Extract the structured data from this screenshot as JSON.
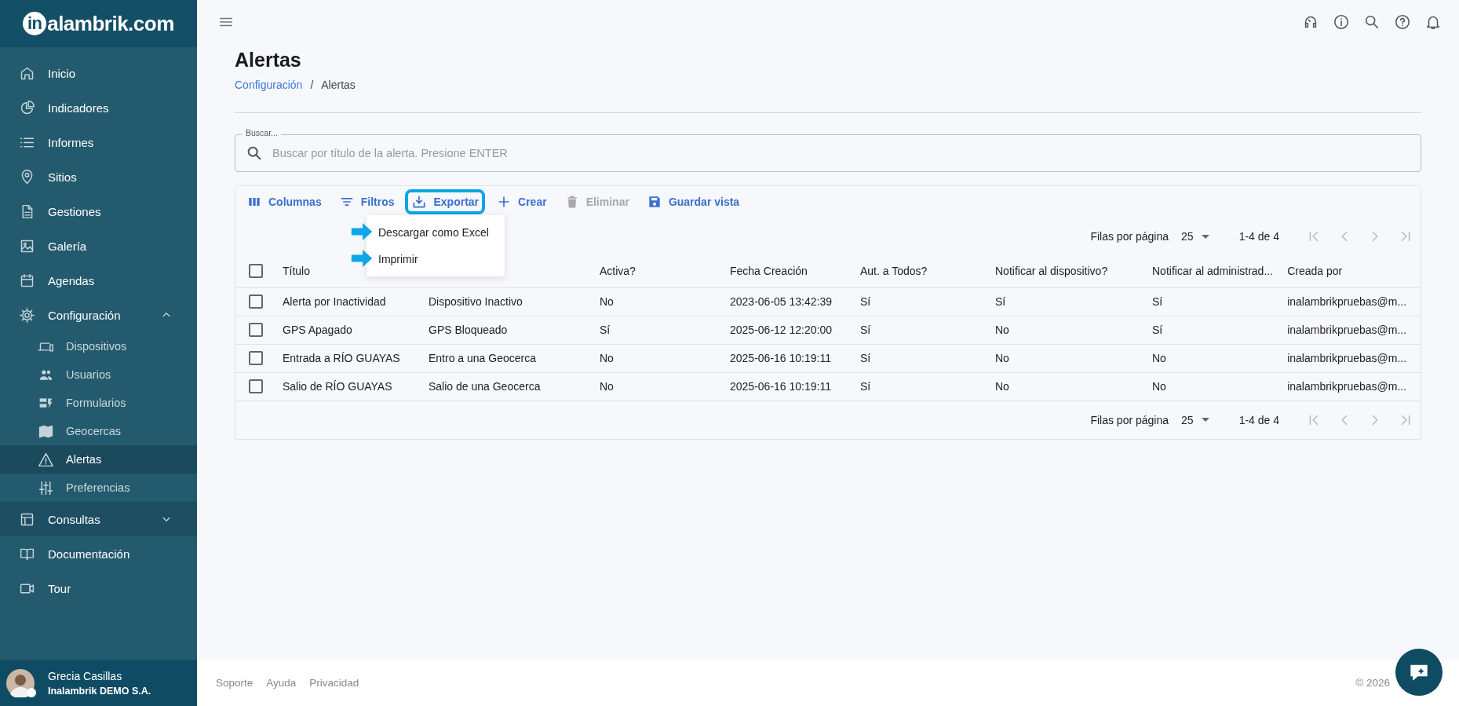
{
  "sidebar": {
    "logo": {
      "mark": "in",
      "text": "alambrik.com"
    },
    "items": [
      {
        "label": "Inicio",
        "selected": false,
        "highlighted": false
      },
      {
        "label": "Indicadores",
        "selected": false,
        "highlighted": false
      },
      {
        "label": "Informes",
        "selected": false,
        "highlighted": false
      },
      {
        "label": "Sitios",
        "selected": false,
        "highlighted": false
      },
      {
        "label": "Gestiones",
        "selected": false,
        "highlighted": false
      },
      {
        "label": "Galería",
        "selected": false,
        "highlighted": false
      },
      {
        "label": "Agendas",
        "selected": false,
        "highlighted": false
      },
      {
        "label": "Configuración",
        "selected": false,
        "highlighted": false,
        "expanded": true,
        "children": [
          {
            "label": "Dispositivos",
            "selected": false
          },
          {
            "label": "Usuarios",
            "selected": false
          },
          {
            "label": "Formularios",
            "selected": false
          },
          {
            "label": "Geocercas",
            "selected": false
          },
          {
            "label": "Alertas",
            "selected": true
          },
          {
            "label": "Preferencias",
            "selected": false
          }
        ]
      },
      {
        "label": "Consultas",
        "selected": false,
        "highlighted": true,
        "expanded": false
      },
      {
        "label": "Documentación",
        "selected": false,
        "highlighted": false
      },
      {
        "label": "Tour",
        "selected": false,
        "highlighted": false
      }
    ],
    "user": {
      "name": "Grecia Casillas",
      "company": "Inalambrik DEMO S.A."
    }
  },
  "page": {
    "title": "Alertas",
    "breadcrumb": [
      {
        "label": "Configuración",
        "link": true
      },
      {
        "label": "Alertas",
        "link": false
      }
    ],
    "breadcrumb_separator": "/"
  },
  "search": {
    "label": "Buscar...",
    "placeholder": "Buscar por título de la alerta. Presione ENTER"
  },
  "toolbar": [
    {
      "label": "Columnas",
      "disabled": false,
      "highlighted": false
    },
    {
      "label": "Filtros",
      "disabled": false,
      "highlighted": false
    },
    {
      "label": "Exportar",
      "disabled": false,
      "highlighted": true
    },
    {
      "label": "Crear",
      "disabled": false,
      "highlighted": false
    },
    {
      "label": "Eliminar",
      "disabled": true,
      "highlighted": false
    },
    {
      "label": "Guardar vista",
      "disabled": false,
      "highlighted": false
    }
  ],
  "export_menu": [
    {
      "label": "Descargar como Excel",
      "pointer_arrow": true
    },
    {
      "label": "Imprimir",
      "pointer_arrow": true
    }
  ],
  "pagination": [
    {
      "rows_label": "Filas por página",
      "rows_value": "25",
      "range": "1-4 de 4",
      "nav_disabled": true
    },
    {
      "rows_label": "Filas por página",
      "rows_value": "25",
      "range": "1-4 de 4",
      "nav_disabled": true
    }
  ],
  "table": {
    "header_checkbox": {
      "checked": false
    },
    "columns": [
      {
        "label": "Título"
      },
      {},
      {
        "label": "Activa?"
      },
      {
        "label": "Fecha Creación"
      },
      {
        "label": "Aut. a Todos?"
      },
      {
        "label": "Notificar al dispositivo?"
      },
      {
        "label": "Notificar al administrad..."
      },
      {
        "label": "Creada por"
      }
    ],
    "rows": [
      {
        "checked": false,
        "cells": [
          "Alerta por Inactividad",
          "Dispositivo Inactivo",
          "No",
          "2023-06-05 13:42:39",
          "Sí",
          "Sí",
          "Sí",
          "inalambrikpruebas@m..."
        ]
      },
      {
        "checked": false,
        "cells": [
          "GPS Apagado",
          "GPS Bloqueado",
          "Sí",
          "2025-06-12 12:20:00",
          "Sí",
          "No",
          "Sí",
          "inalambrikpruebas@m..."
        ]
      },
      {
        "checked": false,
        "cells": [
          "Entrada a RÍO GUAYAS",
          "Entro a una Geocerca",
          "No",
          "2025-06-16 10:19:11",
          "Sí",
          "No",
          "No",
          "inalambrikpruebas@m..."
        ]
      },
      {
        "checked": false,
        "cells": [
          "Salio de RÍO GUAYAS",
          "Salio de una Geocerca",
          "No",
          "2025-06-16 10:19:11",
          "Sí",
          "No",
          "No",
          "inalambrikpruebas@m..."
        ]
      }
    ]
  },
  "footer": {
    "links": [
      "Soporte",
      "Ayuda",
      "Privacidad"
    ],
    "copyright": "© 2026"
  }
}
